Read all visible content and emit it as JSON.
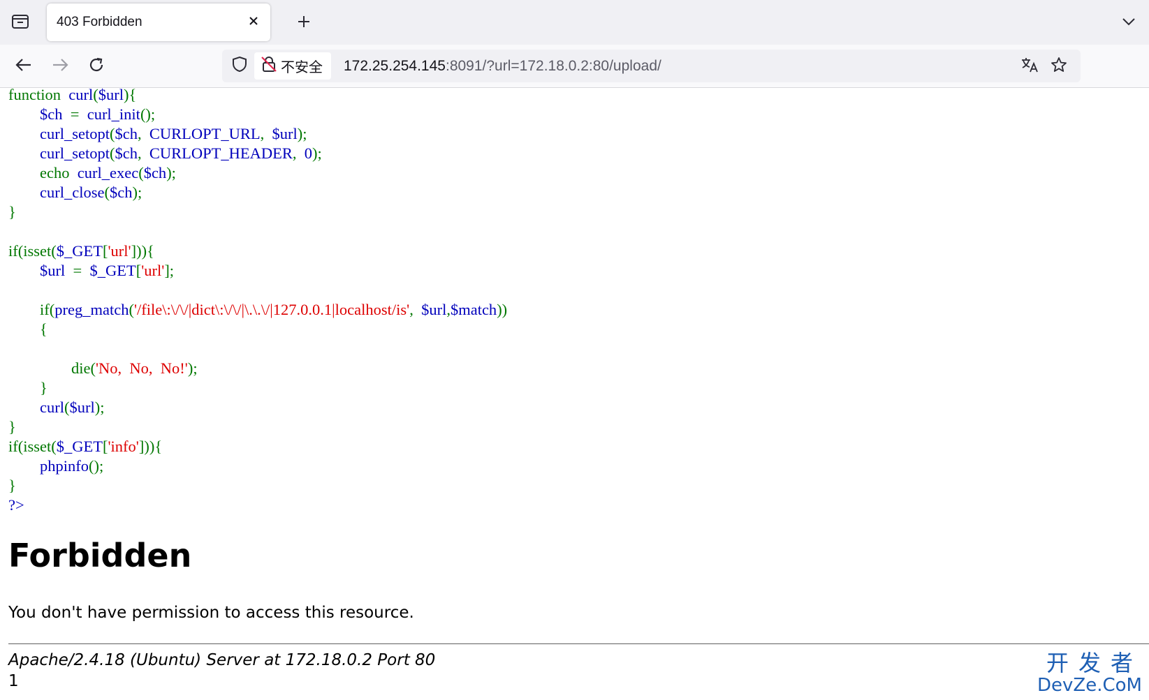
{
  "browser": {
    "tab": {
      "title": "403 Forbidden"
    },
    "address_bar": {
      "security_label": "不安全",
      "url_host": "172.25.254.145",
      "url_rest": ":8091/?url=172.18.0.2:80/upload/"
    }
  },
  "icons": {
    "tab_list": "tab-list-icon",
    "tab_close": "close-icon",
    "new_tab": "plus-icon",
    "tabs_overflow": "chevron-down-icon",
    "back": "arrow-left-icon",
    "forward": "arrow-right-icon",
    "reload": "reload-icon",
    "tracking_protection": "shield-icon",
    "insecure": "lock-slash-icon",
    "translate": "translate-icon",
    "bookmark": "star-icon"
  },
  "code": {
    "lines": [
      [
        {
          "t": "function  ",
          "c": "kw"
        },
        {
          "t": "curl",
          "c": "def"
        },
        {
          "t": "(",
          "c": "kw"
        },
        {
          "t": "$url",
          "c": "def"
        },
        {
          "t": "){",
          "c": "kw"
        }
      ],
      [
        {
          "t": "        ",
          "c": "kw"
        },
        {
          "t": "$ch  ",
          "c": "def"
        },
        {
          "t": "=  ",
          "c": "kw"
        },
        {
          "t": "curl_init",
          "c": "def"
        },
        {
          "t": "();",
          "c": "kw"
        }
      ],
      [
        {
          "t": "        ",
          "c": "kw"
        },
        {
          "t": "curl_setopt",
          "c": "def"
        },
        {
          "t": "(",
          "c": "kw"
        },
        {
          "t": "$ch",
          "c": "def"
        },
        {
          "t": ",  ",
          "c": "kw"
        },
        {
          "t": "CURLOPT_URL",
          "c": "def"
        },
        {
          "t": ",  ",
          "c": "kw"
        },
        {
          "t": "$url",
          "c": "def"
        },
        {
          "t": ");",
          "c": "kw"
        }
      ],
      [
        {
          "t": "        ",
          "c": "kw"
        },
        {
          "t": "curl_setopt",
          "c": "def"
        },
        {
          "t": "(",
          "c": "kw"
        },
        {
          "t": "$ch",
          "c": "def"
        },
        {
          "t": ",  ",
          "c": "kw"
        },
        {
          "t": "CURLOPT_HEADER",
          "c": "def"
        },
        {
          "t": ",  ",
          "c": "kw"
        },
        {
          "t": "0",
          "c": "def"
        },
        {
          "t": ");",
          "c": "kw"
        }
      ],
      [
        {
          "t": "        echo  ",
          "c": "kw"
        },
        {
          "t": "curl_exec",
          "c": "def"
        },
        {
          "t": "(",
          "c": "kw"
        },
        {
          "t": "$ch",
          "c": "def"
        },
        {
          "t": ");",
          "c": "kw"
        }
      ],
      [
        {
          "t": "        ",
          "c": "kw"
        },
        {
          "t": "curl_close",
          "c": "def"
        },
        {
          "t": "(",
          "c": "kw"
        },
        {
          "t": "$ch",
          "c": "def"
        },
        {
          "t": ");",
          "c": "kw"
        }
      ],
      [
        {
          "t": "}",
          "c": "kw"
        }
      ],
      [
        {
          "t": "",
          "c": "kw"
        }
      ],
      [
        {
          "t": "if(isset(",
          "c": "kw"
        },
        {
          "t": "$_GET",
          "c": "def"
        },
        {
          "t": "[",
          "c": "kw"
        },
        {
          "t": "'url'",
          "c": "str"
        },
        {
          "t": "])){",
          "c": "kw"
        }
      ],
      [
        {
          "t": "        ",
          "c": "kw"
        },
        {
          "t": "$url  ",
          "c": "def"
        },
        {
          "t": "=  ",
          "c": "kw"
        },
        {
          "t": "$_GET",
          "c": "def"
        },
        {
          "t": "[",
          "c": "kw"
        },
        {
          "t": "'url'",
          "c": "str"
        },
        {
          "t": "];",
          "c": "kw"
        }
      ],
      [
        {
          "t": "",
          "c": "kw"
        }
      ],
      [
        {
          "t": "        if(",
          "c": "kw"
        },
        {
          "t": "preg_match",
          "c": "def"
        },
        {
          "t": "(",
          "c": "kw"
        },
        {
          "t": "'/file\\:\\/\\/|dict\\:\\/\\/|\\.\\.\\/|127.0.0.1|localhost/is'",
          "c": "str"
        },
        {
          "t": ",  ",
          "c": "kw"
        },
        {
          "t": "$url",
          "c": "def"
        },
        {
          "t": ",",
          "c": "kw"
        },
        {
          "t": "$match",
          "c": "def"
        },
        {
          "t": "))",
          "c": "kw"
        }
      ],
      [
        {
          "t": "        {",
          "c": "kw"
        }
      ],
      [
        {
          "t": "",
          "c": "kw"
        }
      ],
      [
        {
          "t": "                die(",
          "c": "kw"
        },
        {
          "t": "'No,  No,  No!'",
          "c": "str"
        },
        {
          "t": ");",
          "c": "kw"
        }
      ],
      [
        {
          "t": "        }",
          "c": "kw"
        }
      ],
      [
        {
          "t": "        ",
          "c": "kw"
        },
        {
          "t": "curl",
          "c": "def"
        },
        {
          "t": "(",
          "c": "kw"
        },
        {
          "t": "$url",
          "c": "def"
        },
        {
          "t": ");",
          "c": "kw"
        }
      ],
      [
        {
          "t": "}",
          "c": "kw"
        }
      ],
      [
        {
          "t": "if(isset(",
          "c": "kw"
        },
        {
          "t": "$_GET",
          "c": "def"
        },
        {
          "t": "[",
          "c": "kw"
        },
        {
          "t": "'info'",
          "c": "str"
        },
        {
          "t": "])){",
          "c": "kw"
        }
      ],
      [
        {
          "t": "        ",
          "c": "kw"
        },
        {
          "t": "phpinfo",
          "c": "def"
        },
        {
          "t": "();",
          "c": "kw"
        }
      ],
      [
        {
          "t": "}",
          "c": "kw"
        }
      ],
      [
        {
          "t": "?>",
          "c": "def"
        }
      ]
    ]
  },
  "error_page": {
    "title": "Forbidden",
    "message": "You don't have permission to access this resource.",
    "server_signature": "Apache/2.4.18 (Ubuntu) Server at 172.18.0.2 Port 80",
    "trailer": "1"
  },
  "watermark": {
    "line1": "开发者",
    "line2": "DevZe.CoM"
  },
  "colors": {
    "php_keyword": "#007700",
    "php_default": "#0000bb",
    "php_string": "#dd0000",
    "watermark": "#1e5fb4"
  }
}
